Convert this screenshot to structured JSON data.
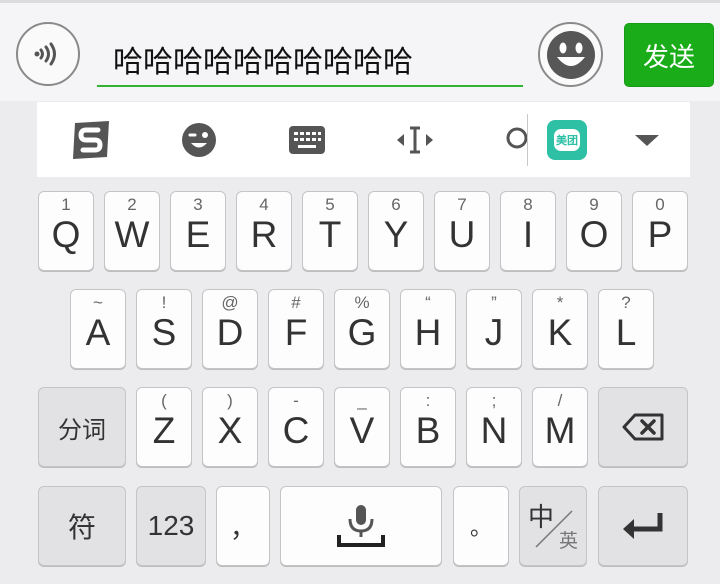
{
  "input_bar": {
    "text": "哈哈哈哈哈哈哈哈哈哈",
    "send_label": "发送"
  },
  "toolbar": {
    "icons": [
      "sogou-logo-icon",
      "wink-emoji-icon",
      "keyboard-icon",
      "cursor-move-icon",
      "search-icon",
      "meituan-app-icon",
      "collapse-arrow-icon"
    ],
    "meituan_label": "美团"
  },
  "keyboard": {
    "row1": [
      {
        "hint": "1",
        "key": "Q"
      },
      {
        "hint": "2",
        "key": "W"
      },
      {
        "hint": "3",
        "key": "E"
      },
      {
        "hint": "4",
        "key": "R"
      },
      {
        "hint": "5",
        "key": "T"
      },
      {
        "hint": "6",
        "key": "Y"
      },
      {
        "hint": "7",
        "key": "U"
      },
      {
        "hint": "8",
        "key": "I"
      },
      {
        "hint": "9",
        "key": "O"
      },
      {
        "hint": "0",
        "key": "P"
      }
    ],
    "row2": [
      {
        "hint": "~",
        "key": "A"
      },
      {
        "hint": "!",
        "key": "S"
      },
      {
        "hint": "@",
        "key": "D"
      },
      {
        "hint": "#",
        "key": "F"
      },
      {
        "hint": "%",
        "key": "G"
      },
      {
        "hint": "“",
        "key": "H"
      },
      {
        "hint": "”",
        "key": "J"
      },
      {
        "hint": "*",
        "key": "K"
      },
      {
        "hint": "?",
        "key": "L"
      }
    ],
    "row3": [
      {
        "hint": "(",
        "key": "Z"
      },
      {
        "hint": ")",
        "key": "X"
      },
      {
        "hint": "-",
        "key": "C"
      },
      {
        "hint": "_",
        "key": "V"
      },
      {
        "hint": ":",
        "key": "B"
      },
      {
        "hint": ";",
        "key": "N"
      },
      {
        "hint": "/",
        "key": "M"
      }
    ],
    "segment_label": "分词",
    "symbol_label": "符",
    "numbers_label": "123",
    "comma_label": "，",
    "period_label": "。",
    "lang_top": "中",
    "lang_bottom": "英"
  },
  "colors": {
    "send_green": "#1aad19",
    "underline_green": "#34b334",
    "meituan_teal": "#2dc0a5",
    "keyboard_bg": "#ececee"
  }
}
